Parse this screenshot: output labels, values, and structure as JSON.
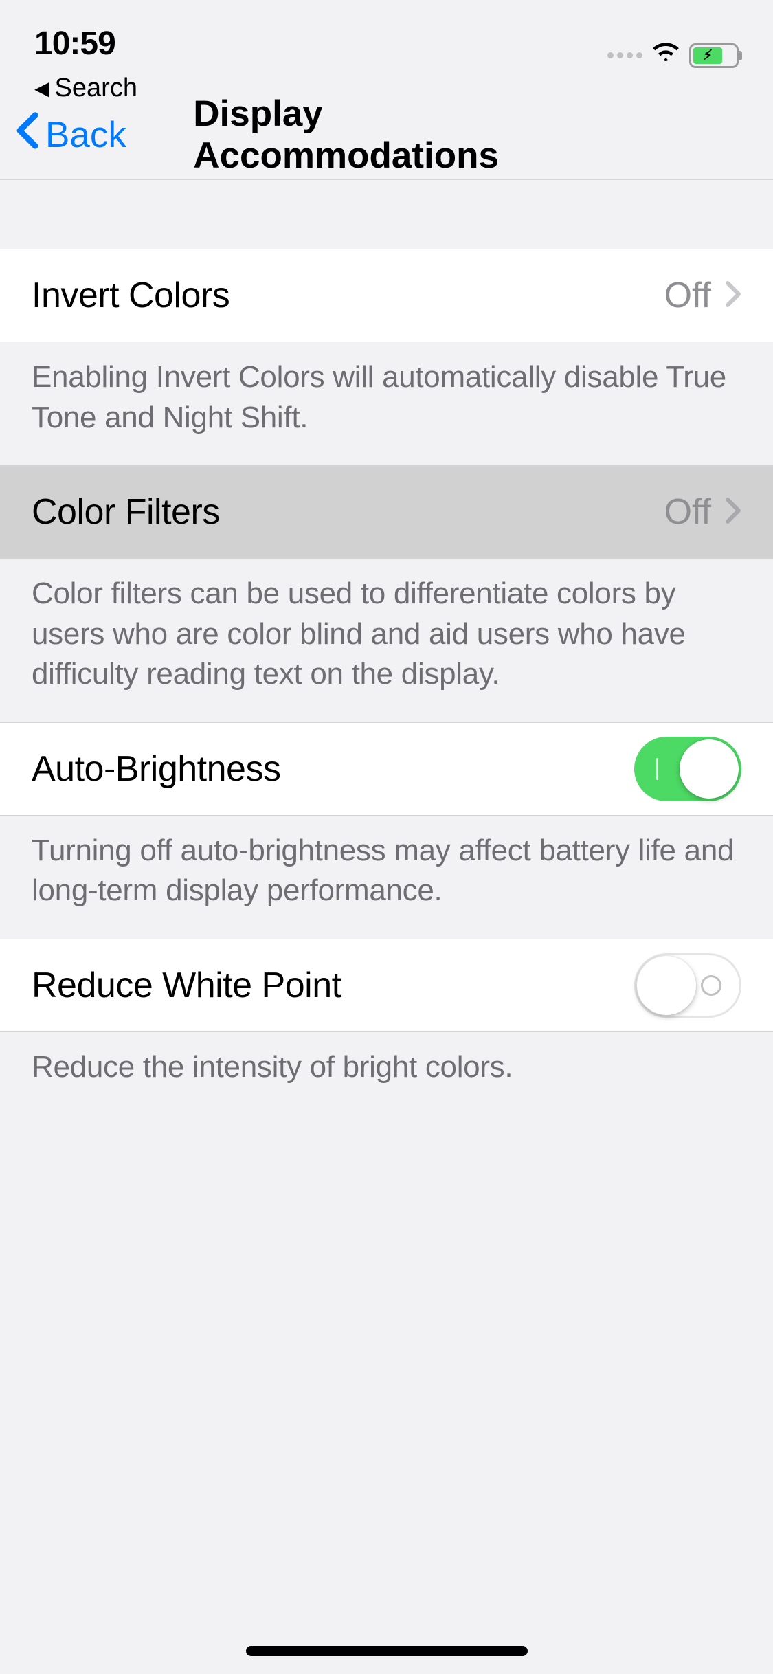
{
  "statusBar": {
    "time": "10:59",
    "breadcrumb": "Search"
  },
  "nav": {
    "back": "Back",
    "title": "Display Accommodations"
  },
  "rows": {
    "invertColors": {
      "label": "Invert Colors",
      "value": "Off",
      "footer": "Enabling Invert Colors will automatically disable True Tone and Night Shift."
    },
    "colorFilters": {
      "label": "Color Filters",
      "value": "Off",
      "footer": "Color filters can be used to differentiate colors by users who are color blind and aid users who have difficulty reading text on the display."
    },
    "autoBrightness": {
      "label": "Auto-Brightness",
      "on": true,
      "footer": "Turning off auto-brightness may affect battery life and long-term display performance."
    },
    "reduceWhitePoint": {
      "label": "Reduce White Point",
      "on": false,
      "footer": "Reduce the intensity of bright colors."
    }
  }
}
